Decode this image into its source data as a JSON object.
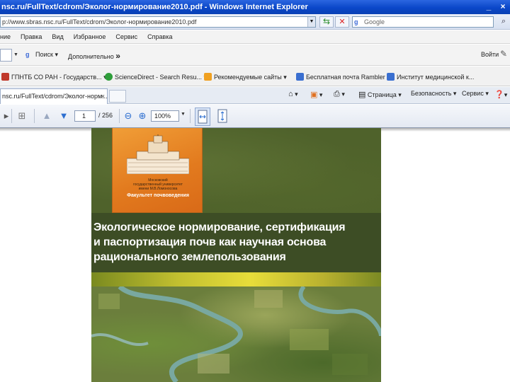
{
  "window": {
    "title": "nsc.ru/FullText/cdrom/Эколог-нормирование2010.pdf - Windows Internet Explorer",
    "buttons": [
      "_",
      "×"
    ]
  },
  "address_bar": {
    "url": "p://www.sbras.nsc.ru/FullText/cdrom/Эколог-нормирование2010.pdf",
    "search_placeholder": "Google"
  },
  "menu": {
    "items": [
      "ние",
      "Правка",
      "Вид",
      "Избранное",
      "Сервис",
      "Справка"
    ]
  },
  "google_toolbar": {
    "search_label": "Поиск",
    "more_label": "Дополнительно",
    "more_glyph": "»",
    "login_label": "Войти"
  },
  "favorites": {
    "items": [
      {
        "label": "ГПНТБ СО РАН - Государств...",
        "color": "#c0392b"
      },
      {
        "label": "ScienceDirect - Search Resu...",
        "color": "#2e9e3a"
      },
      {
        "label": "Рекомендуемые сайты",
        "color": "#f0a020"
      },
      {
        "label": "Бесплатная почта Rambler",
        "color": "#3a6fd0"
      },
      {
        "label": "Институт медицинской к...",
        "color": "#3a6fd0"
      }
    ]
  },
  "tabs": {
    "active_label": "nsc.ru/FullText/cdrom/Эколог-норм...",
    "close_glyph": "×",
    "right_items": [
      "Страница",
      "Безопасность",
      "Сервис"
    ]
  },
  "pdf_toolbar": {
    "current_page": "1",
    "total_pages": "/ 256",
    "zoom": "100%"
  },
  "document": {
    "university_line1": "Московский",
    "university_line2": "государственный университет",
    "university_line3": "имени М.В.Ломоносова",
    "faculty": "Факультет почвоведения",
    "title_line1": "Экологическое нормирование, сертификация",
    "title_line2": "и паспортизация почв как научная основа",
    "title_line3": "рационального землепользования"
  }
}
